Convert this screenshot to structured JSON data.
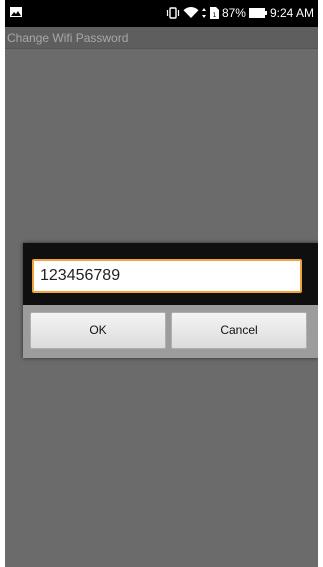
{
  "status_bar": {
    "battery_percent": "87%",
    "time": "9:24 AM"
  },
  "app_bar": {
    "title": "Change Wifi Password"
  },
  "dialog": {
    "password_value": "123456789",
    "ok_label": "OK",
    "cancel_label": "Cancel"
  },
  "colors": {
    "background": "#6b6b6b",
    "status_bar": "#000000",
    "field_focus_border": "#f2a23a",
    "button_face": "#e8e8e8"
  },
  "icons": [
    "image-icon",
    "vibrate-icon",
    "wifi-icon",
    "data-transfer-icon",
    "sim-icon",
    "battery-icon"
  ]
}
